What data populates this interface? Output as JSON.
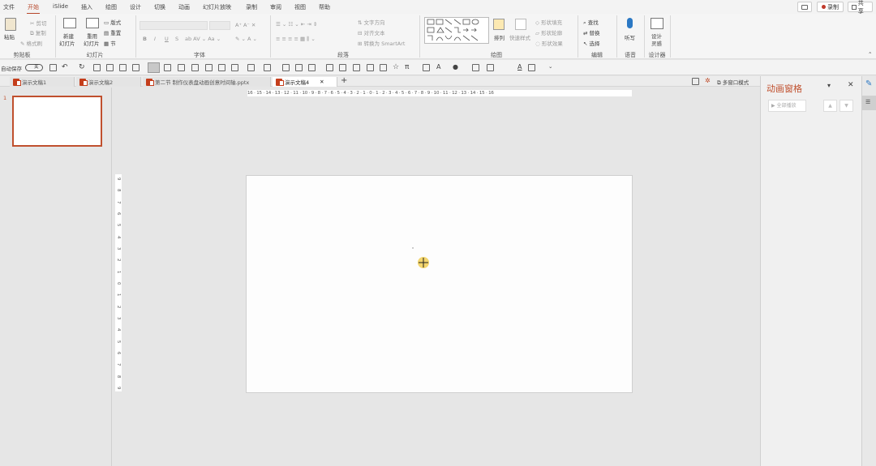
{
  "ribbon_tabs": [
    "文件",
    "开始",
    "iSlide",
    "插入",
    "绘图",
    "设计",
    "切换",
    "动画",
    "幻灯片放映",
    "录制",
    "审阅",
    "视图",
    "帮助"
  ],
  "active_tab": "开始",
  "top_right": {
    "comment_icon": "comment-icon",
    "record": "录制",
    "share": "共享"
  },
  "clipboard": {
    "paste": "粘贴",
    "cut": "剪切",
    "copy": "复制",
    "format_painter": "格式刷",
    "label": "剪贴板"
  },
  "slides_group": {
    "new_slide_line1": "新建",
    "new_slide_line2": "幻灯片",
    "reuse_line1": "重用",
    "reuse_line2": "幻灯片",
    "layout": "版式",
    "reset": "重置",
    "section": "节",
    "label": "幻灯片"
  },
  "font_group": {
    "bold": "B",
    "italic": "I",
    "underline": "U",
    "strike": "S",
    "label": "字体"
  },
  "paragraph_group": {
    "text_direction": "文字方向",
    "align_text": "对齐文本",
    "smartart": "转换为 SmartArt",
    "label": "段落"
  },
  "drawing_group": {
    "arrange": "排列",
    "quick_styles": "快速样式",
    "shape_fill": "形状填充",
    "shape_outline": "形状轮廓",
    "shape_effects": "形状效果",
    "label": "绘图"
  },
  "editing_group": {
    "find": "查找",
    "replace": "替换",
    "select": "选择",
    "label": "编辑"
  },
  "voice_group": {
    "dictate": "听写",
    "label": "语音"
  },
  "designer_group": {
    "line1": "设计",
    "line2": "灵感",
    "label": "设计器"
  },
  "qat": {
    "autosave": "自动保存",
    "toggle": "关"
  },
  "doc_tabs": [
    {
      "title": "演示文稿1",
      "active": false
    },
    {
      "title": "演示文稿2",
      "active": false
    },
    {
      "title": "第二节 制作仪表盘动画创意时间轴.pptx",
      "active": false
    },
    {
      "title": "演示文稿4",
      "active": true
    }
  ],
  "multi_window": "多窗口模式",
  "thumbnail": {
    "number": "1"
  },
  "hruler_text": "16 · 15 · 14 · 13 · 12 · 11 · 10 · 9 · 8 · 7 · 6 · 5 · 4 · 3 · 2 · 1 · 0 · 1 · 2 · 3 · 4 · 5 · 6 · 7 · 8 · 9 · 10 · 11 · 12 · 13 · 14 · 15 · 16",
  "vruler_labels": [
    "9",
    "8",
    "7",
    "6",
    "5",
    "4",
    "3",
    "2",
    "1",
    "0",
    "1",
    "2",
    "3",
    "4",
    "5",
    "6",
    "7",
    "8",
    "9"
  ],
  "anim_pane": {
    "title": "动画窗格",
    "play_all": "全部播放"
  },
  "colors": {
    "accent": "#b7472a",
    "thumb_border": "#c0502e"
  }
}
